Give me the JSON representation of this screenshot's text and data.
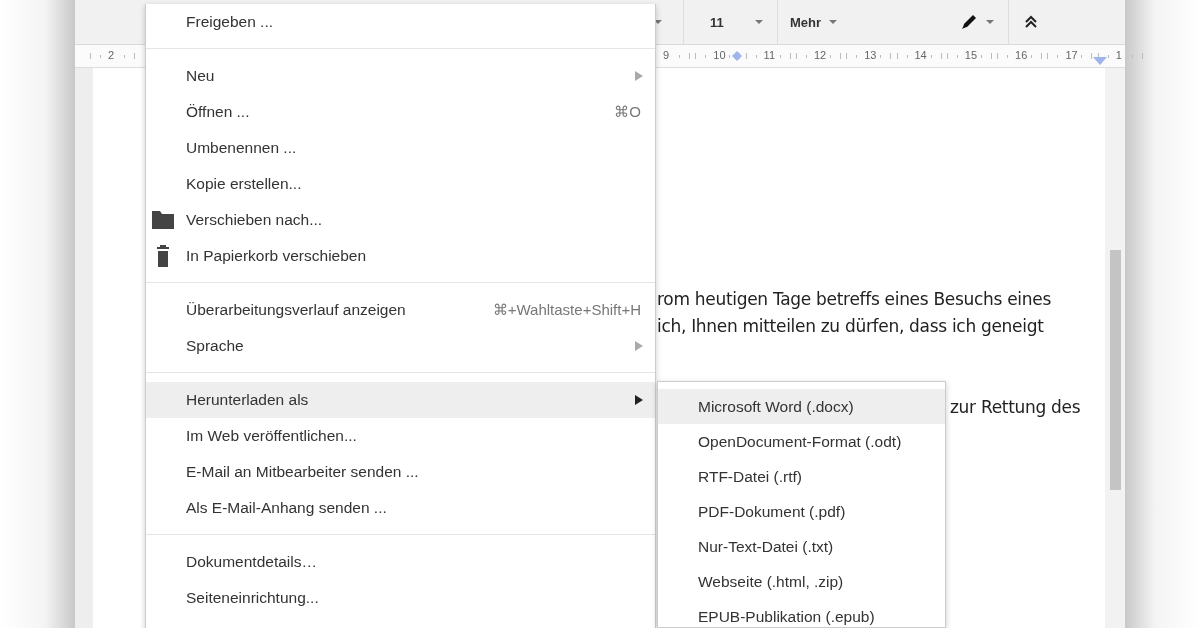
{
  "toolbar": {
    "font_size": "11",
    "more": "Mehr"
  },
  "ruler": {
    "labels": [
      "2",
      "9",
      "10",
      "11",
      "12",
      "13",
      "14",
      "15",
      "16",
      "17",
      "1"
    ]
  },
  "document": {
    "lines": [
      {
        "text": "rom heutigen Tage betreffs eines Besuchs eines",
        "indent": false
      },
      {
        "text": "ich, Ihnen mitteilen zu dürfen, dass ich geneigt",
        "indent": false
      },
      {
        "text": "zur Rettung des",
        "indent": true
      }
    ]
  },
  "file_menu": {
    "groups": [
      [
        {
          "label": "Freigeben ...",
          "kind": "plain",
          "has_submenu": false,
          "selected": false
        }
      ],
      [
        {
          "label": "Neu",
          "kind": "plain",
          "has_submenu": true,
          "selected": false
        },
        {
          "label": "Öffnen ...",
          "kind": "plain",
          "shortcut": "⌘O",
          "has_submenu": false,
          "selected": false
        },
        {
          "label": "Umbenennen ...",
          "kind": "plain",
          "has_submenu": false,
          "selected": false
        },
        {
          "label": "Kopie erstellen...",
          "kind": "plain",
          "has_submenu": false,
          "selected": false
        },
        {
          "label": "Verschieben nach...",
          "kind": "move",
          "has_submenu": false,
          "selected": false
        },
        {
          "label": "In Papierkorb verschieben",
          "kind": "delete",
          "has_submenu": false,
          "selected": false
        }
      ],
      [
        {
          "label": "Überarbeitungsverlauf anzeigen",
          "kind": "plain",
          "shortcut": "⌘+Wahltaste+Shift+H",
          "has_submenu": false,
          "selected": false
        },
        {
          "label": "Sprache",
          "kind": "plain",
          "has_submenu": true,
          "selected": false
        }
      ],
      [
        {
          "label": "Herunterladen als",
          "kind": "plain",
          "has_submenu": true,
          "selected": true
        },
        {
          "label": "Im Web veröffentlichen...",
          "kind": "plain",
          "has_submenu": false,
          "selected": false
        },
        {
          "label": "E-Mail an Mitbearbeiter senden ...",
          "kind": "plain",
          "has_submenu": false,
          "selected": false
        },
        {
          "label": "Als E-Mail-Anhang senden ...",
          "kind": "plain",
          "has_submenu": false,
          "selected": false
        }
      ],
      [
        {
          "label": "Dokumentdetails…",
          "kind": "plain",
          "has_submenu": false,
          "selected": false
        },
        {
          "label": "Seiteneinrichtung...",
          "kind": "plain",
          "has_submenu": false,
          "selected": false
        }
      ]
    ]
  },
  "download_submenu": {
    "items": [
      {
        "label": "Microsoft Word (.docx)",
        "selected": true
      },
      {
        "label": "OpenDocument-Format (.odt)",
        "selected": false
      },
      {
        "label": "RTF-Datei (.rtf)",
        "selected": false
      },
      {
        "label": "PDF-Dokument (.pdf)",
        "selected": false
      },
      {
        "label": "Nur-Text-Datei (.txt)",
        "selected": false
      },
      {
        "label": "Webseite (.html, .zip)",
        "selected": false
      },
      {
        "label": "EPUB-Publikation (.epub)",
        "selected": false
      }
    ]
  }
}
